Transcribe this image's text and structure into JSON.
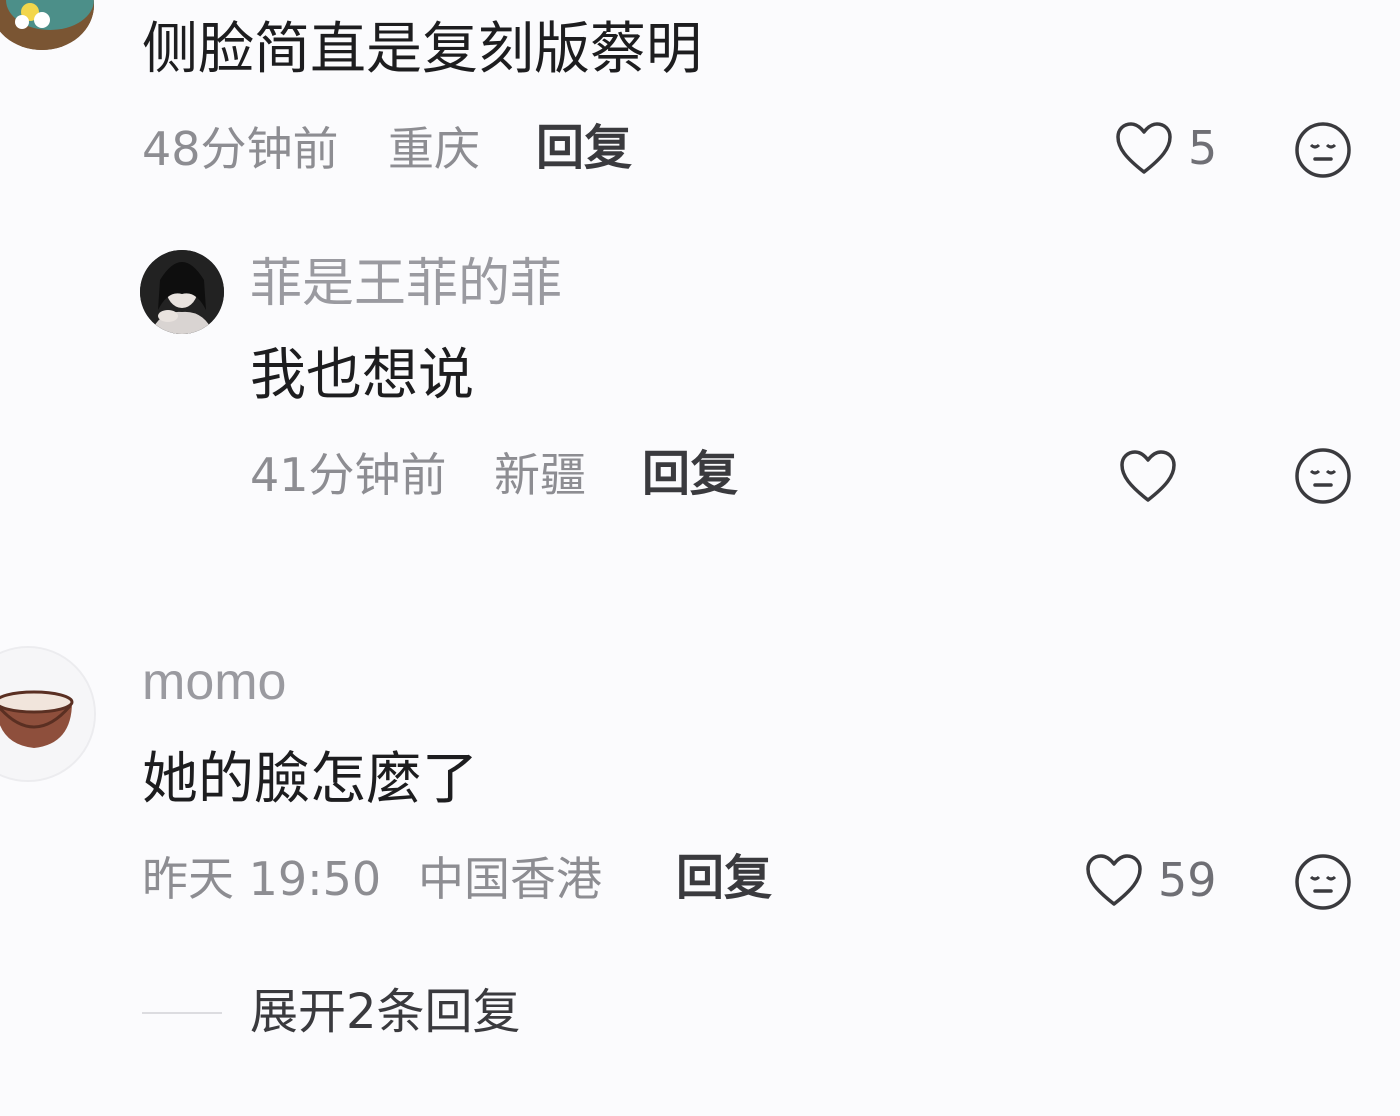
{
  "comments": [
    {
      "text": "侧脸简直是复刻版蔡明",
      "time": "48分钟前",
      "location": "重庆",
      "reply_label": "回复",
      "likes": "5",
      "like_icon": "heart-outline-icon",
      "dislike_icon": "meh-face-icon"
    },
    {
      "username": "菲是王菲的菲",
      "text": "我也想说",
      "time": "41分钟前",
      "location": "新疆",
      "reply_label": "回复",
      "likes": "",
      "like_icon": "heart-outline-icon",
      "dislike_icon": "meh-face-icon"
    },
    {
      "username": "momo",
      "text": "她的臉怎麼了",
      "time": "昨天 19:50",
      "location": "中国香港",
      "reply_label": "回复",
      "likes": "59",
      "like_icon": "heart-outline-icon",
      "dislike_icon": "meh-face-icon"
    }
  ],
  "expand_replies": {
    "label": "展开2条回复"
  },
  "colors": {
    "background": "#fbfbfd",
    "text": "#1d1d1f",
    "meta": "#8d8d92",
    "reply": "#3a3a3e"
  }
}
